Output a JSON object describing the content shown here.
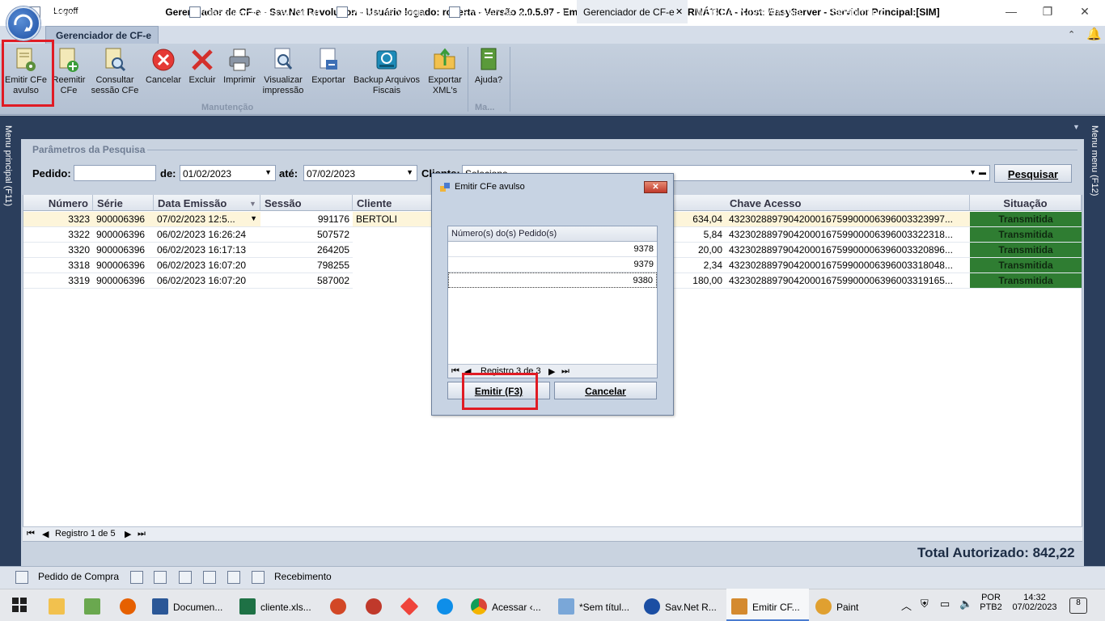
{
  "window": {
    "logoff": "Logoff",
    "title": "Gerenciador de CF-e - Sav.Net Revolution - Usuário logado: roberta - Versão 2.0.5.97 - Empresa: EASY INFO INFORMÁTICA - Host: EasyServer - Servidor Principal:[SIM]",
    "minimize": "—",
    "restore": "❐",
    "close": "✕"
  },
  "ribbon": {
    "active_tab": "Gerenciador de CF-e",
    "collapse": "⌃",
    "bell": "🔔",
    "buttons": [
      {
        "label1": "Emitir CFe",
        "label2": "avulso",
        "icon": "document-gear-icon"
      },
      {
        "label1": "Reemitir",
        "label2": "CFe",
        "icon": "document-add-icon"
      },
      {
        "label1": "Consultar",
        "label2": "sessão CFe",
        "icon": "document-search-icon"
      },
      {
        "label1": "Cancelar",
        "label2": "",
        "icon": "cancel-icon"
      },
      {
        "label1": "Excluir",
        "label2": "",
        "icon": "delete-x-icon"
      },
      {
        "label1": "Imprimir",
        "label2": "",
        "icon": "printer-icon"
      },
      {
        "label1": "Visualizar",
        "label2": "impressão",
        "icon": "print-preview-icon"
      },
      {
        "label1": "Exportar",
        "label2": "",
        "icon": "export-icon"
      },
      {
        "label1": "Backup Arquivos",
        "label2": "Fiscais",
        "icon": "backup-icon"
      },
      {
        "label1": "Exportar",
        "label2": "XML's",
        "icon": "folder-export-icon"
      },
      {
        "label1": "Ajuda?",
        "label2": "",
        "icon": "help-book-icon"
      }
    ],
    "group_manutencao": "Manutenção",
    "group_ma": "Ma..."
  },
  "side": {
    "left": "Menu principal (F11)",
    "right": "Menu menu (F12)"
  },
  "tabs": [
    {
      "label": "Produto"
    },
    {
      "label": "Classe Fiscal"
    },
    {
      "label": "Classificação Fiscal (NCM)"
    },
    {
      "label": "Pedido de Venda"
    },
    {
      "label": "Emissão de Nota Fiscal"
    },
    {
      "label": "Gerenciador de CF-e",
      "close": "✕"
    },
    {
      "label": "WEB EASY-(978/0)-Loja:1"
    },
    {
      "label": "Recebimento"
    }
  ],
  "tabs_menu": "▼",
  "search": {
    "group_title": "Parâmetros da Pesquisa",
    "pedido_label": "Pedido:",
    "pedido_value": "",
    "de_label": "de:",
    "de_value": "01/02/2023",
    "ate_label": "até:",
    "ate_value": "07/02/2023",
    "cliente_label": "Cliente:",
    "cliente_value": "Selecione",
    "button": "Pesquisar"
  },
  "grid": {
    "columns": [
      "Número",
      "Série",
      "Data Emissão",
      "Sessão",
      "Cliente",
      "Chave Acesso",
      "Situação"
    ],
    "rows": [
      {
        "numero": "3323",
        "serie": "900006396",
        "data": "07/02/2023 12:5...",
        "sessao": "991176",
        "cliente": "BERTOLI",
        "valor": "634,04",
        "chave": "432302889790420001675990000639600332399​7...",
        "situacao": "Transmitida"
      },
      {
        "numero": "3322",
        "serie": "900006396",
        "data": "06/02/2023 16:26:24",
        "sessao": "507572",
        "cliente": "",
        "valor": "5,84",
        "chave": "43230288979042000167599000063960033223​18...",
        "situacao": "Transmitida"
      },
      {
        "numero": "3320",
        "serie": "900006396",
        "data": "06/02/2023 16:17:13",
        "sessao": "264205",
        "cliente": "",
        "valor": "20,00",
        "chave": "43230288979042000167599000063960033208​96...",
        "situacao": "Transmitida"
      },
      {
        "numero": "3318",
        "serie": "900006396",
        "data": "06/02/2023 16:07:20",
        "sessao": "798255",
        "cliente": "",
        "valor": "2,34",
        "chave": "43230288979042000167599000063960033180​48...",
        "situacao": "Transmitida"
      },
      {
        "numero": "3319",
        "serie": "900006396",
        "data": "06/02/2023 16:07:20",
        "sessao": "587002",
        "cliente": "",
        "valor": "180,00",
        "chave": "43230288979042000167599000063960033191​65...",
        "situacao": "Transmitida"
      }
    ],
    "footer": "Registro 1 de 5",
    "total": "Total Autorizado: 842,22"
  },
  "dialog": {
    "title": "Emitir CFe avulso",
    "column": "Número(s) do(s) Pedido(s)",
    "rows": [
      "9378",
      "9379",
      "9380"
    ],
    "footer": "Registro 3 de 3",
    "emitir": "Emitir (F3)",
    "cancelar": "Cancelar"
  },
  "statusbar": {
    "pedido_compra": "Pedido de Compra",
    "recebimento": "Recebimento"
  },
  "taskbar": {
    "items": [
      {
        "label": "Documen...",
        "color": "#2b5797"
      },
      {
        "label": "cliente.xls...",
        "color": "#1e7145"
      },
      {
        "label": "Acessar ‹...",
        "color": "#dd4b39"
      },
      {
        "label": "*Sem títul...",
        "color": "#7aa7d8"
      },
      {
        "label": "Sav.Net R...",
        "color": "#1b4ea3"
      },
      {
        "label": "Emitir CF...",
        "color": "#d48a2f"
      },
      {
        "label": "Paint",
        "color": "#e0a030"
      }
    ],
    "lang1": "POR",
    "lang2": "PTB2",
    "time": "14:32",
    "date": "07/02/2023",
    "notif": "8"
  }
}
